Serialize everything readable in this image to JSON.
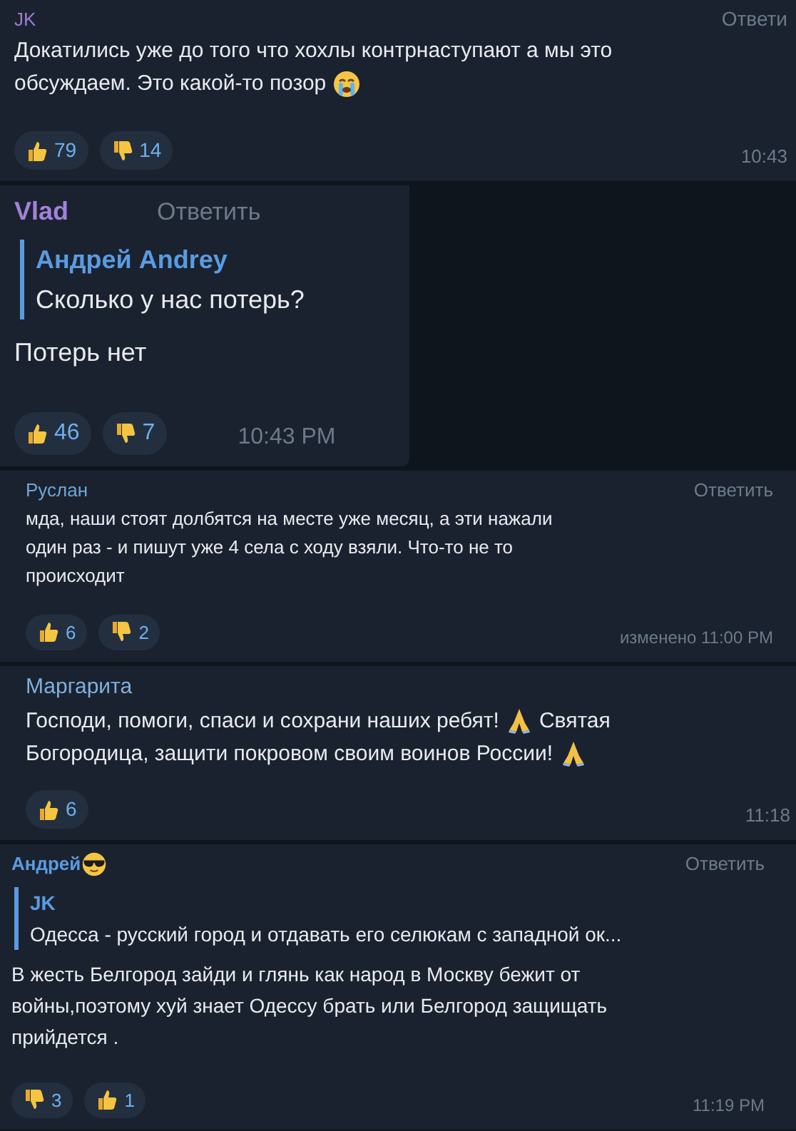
{
  "comments": [
    {
      "author": "JK",
      "color": "#9b7fd6",
      "reply_button": "Ответи",
      "lines": [
        [
          {
            "kind": "text",
            "text": "Докатились уже до того что хохлы контрнаступают а мы это"
          }
        ],
        [
          {
            "kind": "text",
            "text": "обсуждаем. Это какой-то позор"
          },
          {
            "kind": "sob"
          }
        ]
      ],
      "reactions": [
        {
          "kind": "like",
          "count": "79"
        },
        {
          "kind": "dislike",
          "count": "14"
        }
      ],
      "time": "10:43"
    },
    {
      "author": "Vlad",
      "color": "#a283d8",
      "reply_button": "Ответить",
      "quote": {
        "author": "Андрей Andrey",
        "text": "Сколько у нас потерь?"
      },
      "lines": [
        [
          {
            "kind": "text",
            "text": "Потерь нет"
          }
        ]
      ],
      "reactions": [
        {
          "kind": "like",
          "count": "46"
        },
        {
          "kind": "dislike",
          "count": "7"
        }
      ],
      "time": "10:43 PM"
    },
    {
      "author": "Руслан",
      "color": "#6ea6d6",
      "reply_button": "Ответить",
      "lines": [
        [
          {
            "kind": "text",
            "text": "мда, наши стоят долбятся на месте уже месяц, а эти нажали"
          }
        ],
        [
          {
            "kind": "text",
            "text": "один раз - и пишут уже 4 села с ходу взяли. Что-то не то"
          }
        ],
        [
          {
            "kind": "text",
            "text": "происходит"
          }
        ]
      ],
      "reactions": [
        {
          "kind": "like",
          "count": "6"
        },
        {
          "kind": "dislike",
          "count": "2"
        }
      ],
      "time": "изменено 11:00 PM"
    },
    {
      "author": "Маргарита",
      "color": "#7fb0dc",
      "lines": [
        [
          {
            "kind": "text",
            "text": "Господи, помоги, спаси и сохрани наших ребят!"
          },
          {
            "kind": "pray"
          },
          {
            "kind": "text",
            "text": "Святая"
          }
        ],
        [
          {
            "kind": "text",
            "text": "Богородица, защити покровом своим воинов России!"
          },
          {
            "kind": "pray"
          }
        ]
      ],
      "reactions": [
        {
          "kind": "like",
          "count": "6"
        }
      ],
      "time": "11:18"
    },
    {
      "author": "Андрей",
      "author_icon": {
        "kind": "shades"
      },
      "color": "#5b9be0",
      "reply_button": "Ответить",
      "quote": {
        "author": "JK",
        "text": "Одесса - русский город и отдавать его селюкам с западной ок..."
      },
      "lines": [
        [
          {
            "kind": "text",
            "text": "В жесть Белгород зайди и глянь как народ в Москву бежит от"
          }
        ],
        [
          {
            "kind": "text",
            "text": "войны,поэтому хуй знает Одессу брать или Белгород защищать"
          }
        ],
        [
          {
            "kind": "text",
            "text": "прийдется ."
          }
        ]
      ],
      "reactions": [
        {
          "kind": "dislike",
          "count": "3"
        },
        {
          "kind": "like",
          "count": "1"
        }
      ],
      "time": "11:19 PM"
    }
  ]
}
